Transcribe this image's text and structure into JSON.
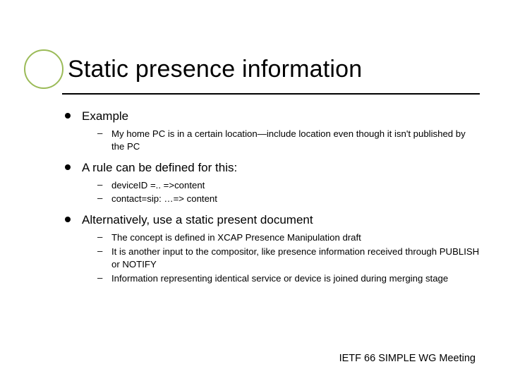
{
  "slide": {
    "title": "Static presence information",
    "bullets": [
      {
        "label": "Example",
        "sub": [
          "My home PC is in a certain location—include location even though it isn't published by the PC"
        ]
      },
      {
        "label": "A rule can be defined for this:",
        "sub": [
          "deviceID =..  =>content",
          "contact=sip: …=> content"
        ]
      },
      {
        "label": "Alternatively, use a static present document",
        "sub": [
          "The concept is defined in XCAP Presence Manipulation draft",
          "It is another input to the compositor, like presence information received through PUBLISH or NOTIFY",
          "Information representing identical service or device is joined during merging stage"
        ]
      }
    ],
    "footer": "IETF 66 SIMPLE WG Meeting"
  }
}
